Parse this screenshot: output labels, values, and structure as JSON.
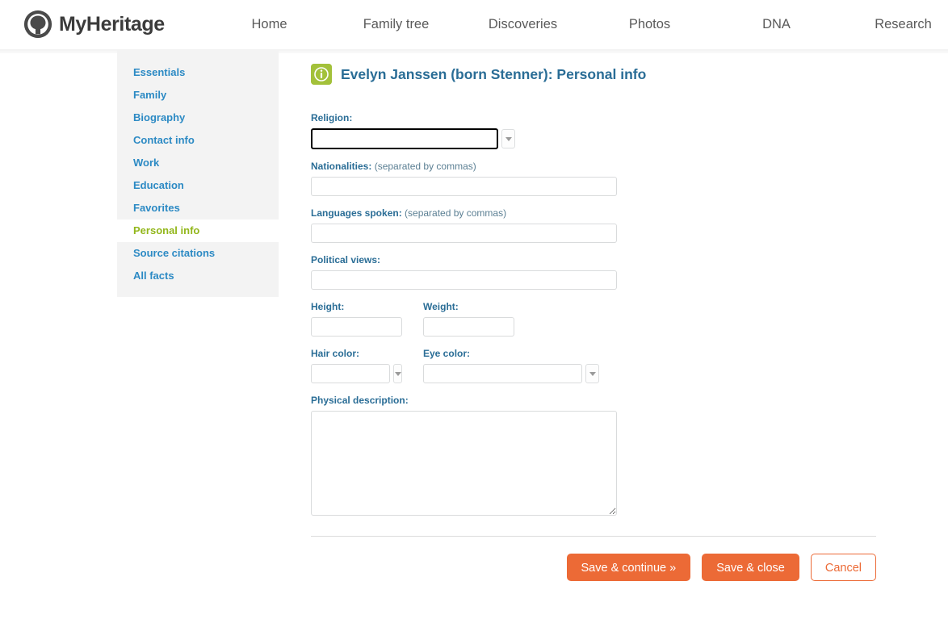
{
  "header": {
    "logo_text": "MyHeritage",
    "logo_icon": "myheritage-tree-logo-icon",
    "nav": [
      {
        "label": "Home",
        "name": "nav-item-home"
      },
      {
        "label": "Family tree",
        "name": "nav-item-family-tree"
      },
      {
        "label": "Discoveries",
        "name": "nav-item-discoveries"
      },
      {
        "label": "Photos",
        "name": "nav-item-photos"
      },
      {
        "label": "DNA",
        "name": "nav-item-dna"
      },
      {
        "label": "Research",
        "name": "nav-item-research"
      }
    ]
  },
  "sidebar": {
    "items": [
      {
        "label": "Essentials",
        "active": false
      },
      {
        "label": "Family",
        "active": false
      },
      {
        "label": "Biography",
        "active": false
      },
      {
        "label": "Contact info",
        "active": false
      },
      {
        "label": "Work",
        "active": false
      },
      {
        "label": "Education",
        "active": false
      },
      {
        "label": "Favorites",
        "active": false
      },
      {
        "label": "Personal info",
        "active": true
      },
      {
        "label": "Source citations",
        "active": false
      },
      {
        "label": "All facts",
        "active": false
      }
    ]
  },
  "main": {
    "title": "Evelyn Janssen (born Stenner): Personal info",
    "title_icon": "info-icon",
    "fields": {
      "religion": {
        "label": "Religion:",
        "value": "",
        "placeholder": "",
        "has_dropdown": true,
        "focused": true
      },
      "nationalities": {
        "label": "Nationalities:",
        "hint": "(separated by commas)",
        "value": "",
        "placeholder": ""
      },
      "languages_spoken": {
        "label": "Languages spoken:",
        "hint": "(separated by commas)",
        "value": "",
        "placeholder": ""
      },
      "political_views": {
        "label": "Political views:",
        "value": "",
        "placeholder": ""
      },
      "height": {
        "label": "Height:",
        "value": "",
        "placeholder": ""
      },
      "weight": {
        "label": "Weight:",
        "value": "",
        "placeholder": ""
      },
      "hair_color": {
        "label": "Hair color:",
        "value": "",
        "placeholder": "",
        "has_dropdown": true
      },
      "eye_color": {
        "label": "Eye color:",
        "value": "",
        "placeholder": "",
        "has_dropdown": true
      },
      "physical_description": {
        "label": "Physical description:",
        "value": "",
        "placeholder": ""
      }
    }
  },
  "buttons": {
    "save_continue": "Save & continue »",
    "save_close": "Save & close",
    "cancel": "Cancel"
  },
  "colors": {
    "accent_orange": "#ec6a36",
    "link_blue": "#2c8ac4",
    "label_blue": "#2a6d96",
    "active_green": "#93b71c",
    "info_icon_green": "#a3c13a"
  }
}
